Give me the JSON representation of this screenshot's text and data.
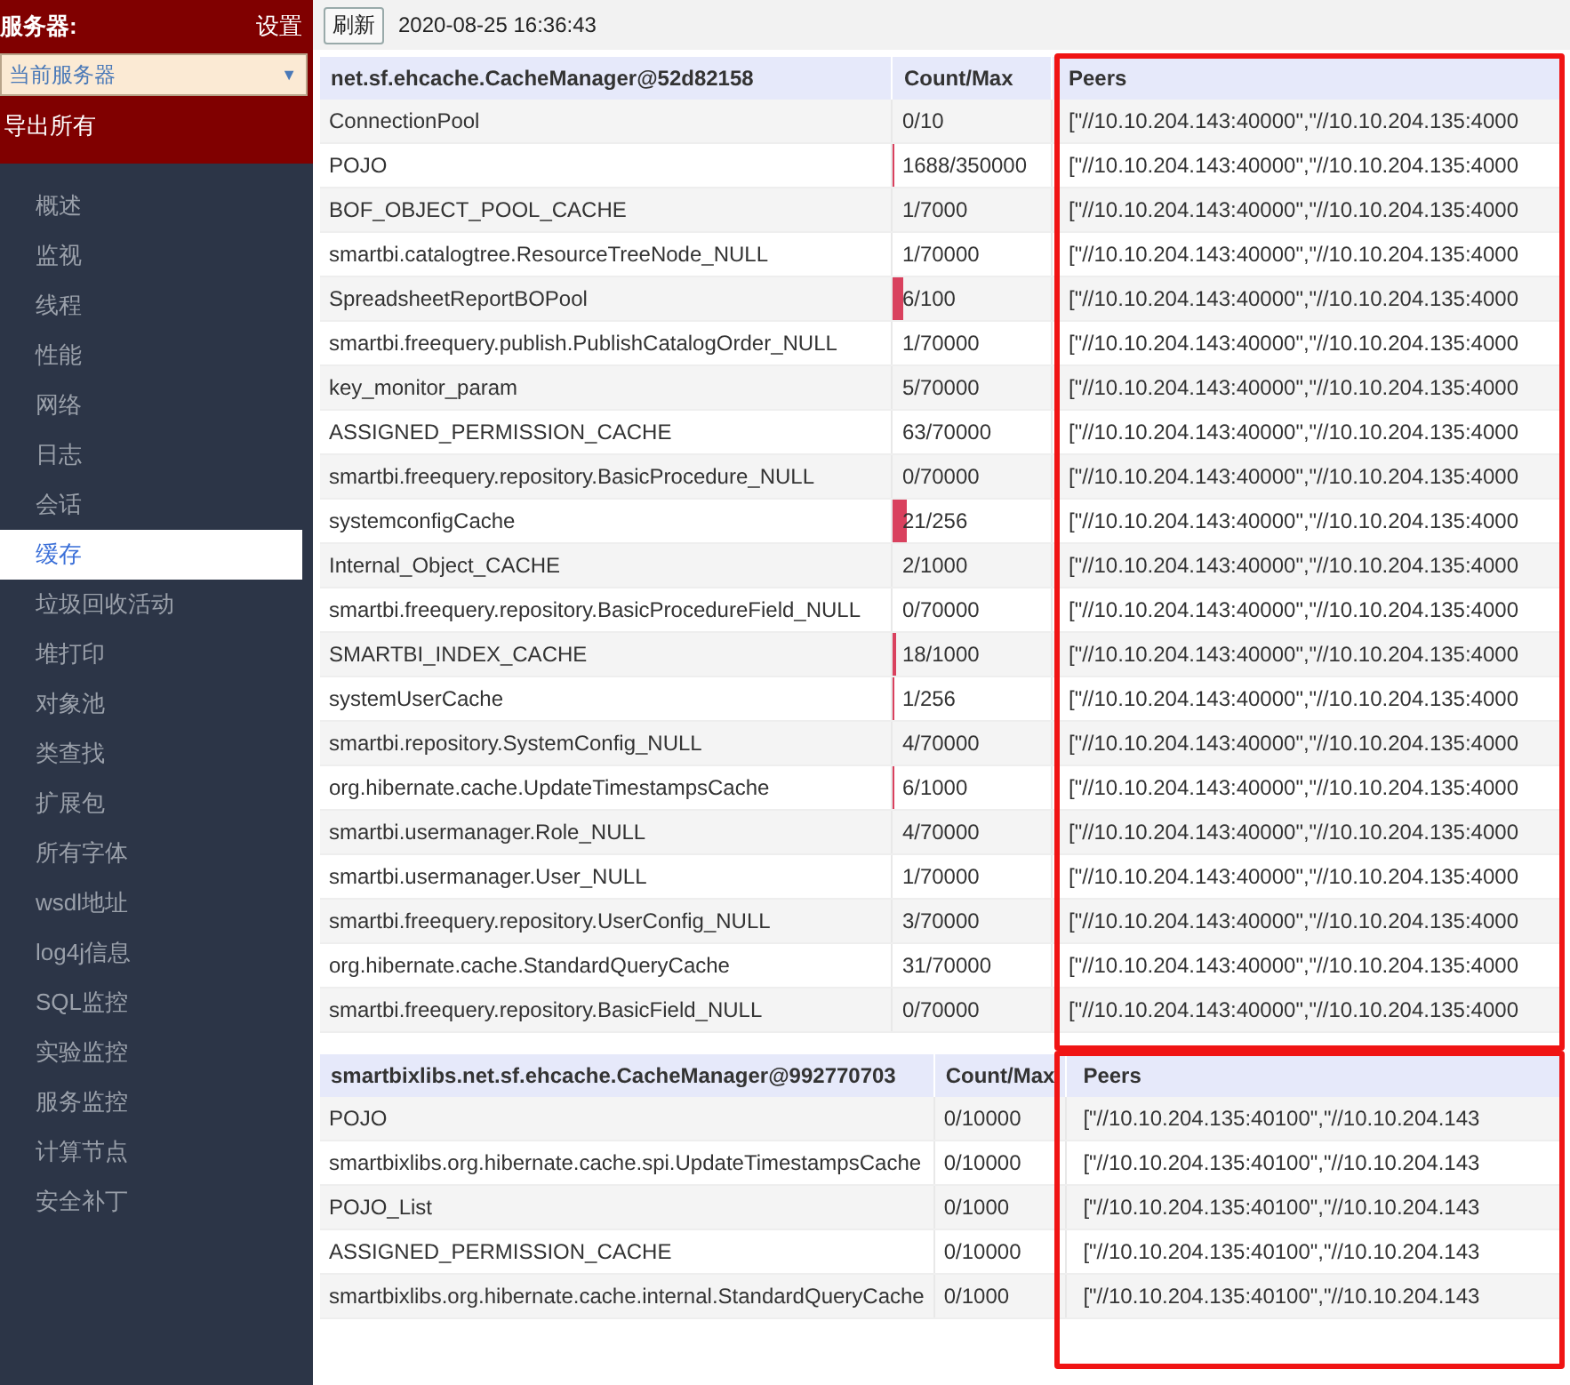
{
  "sidebar": {
    "title": "服务器:",
    "settings_link": "设置",
    "server_select": {
      "value": "当前服务器",
      "arrow": "▼"
    },
    "export_link": "导出所有",
    "items": [
      {
        "label": "概述",
        "selected": false
      },
      {
        "label": "监视",
        "selected": false
      },
      {
        "label": "线程",
        "selected": false
      },
      {
        "label": "性能",
        "selected": false
      },
      {
        "label": "网络",
        "selected": false
      },
      {
        "label": "日志",
        "selected": false
      },
      {
        "label": "会话",
        "selected": false
      },
      {
        "label": "缓存",
        "selected": true
      },
      {
        "label": "垃圾回收活动",
        "selected": false
      },
      {
        "label": "堆打印",
        "selected": false
      },
      {
        "label": "对象池",
        "selected": false
      },
      {
        "label": "类查找",
        "selected": false
      },
      {
        "label": "扩展包",
        "selected": false
      },
      {
        "label": "所有字体",
        "selected": false
      },
      {
        "label": "wsdl地址",
        "selected": false
      },
      {
        "label": "log4j信息",
        "selected": false
      },
      {
        "label": "SQL监控",
        "selected": false
      },
      {
        "label": "实验监控",
        "selected": false
      },
      {
        "label": "服务监控",
        "selected": false
      },
      {
        "label": "计算节点",
        "selected": false
      },
      {
        "label": "安全补丁",
        "selected": false
      }
    ]
  },
  "toolbar": {
    "refresh_button": "刷新",
    "timestamp": "2020-08-25 16:36:43"
  },
  "tables": [
    {
      "columns": [
        "net.sf.ehcache.CacheManager@52d82158",
        "Count/Max",
        "Peers"
      ],
      "highlighted": true,
      "rows": [
        {
          "name": "ConnectionPool",
          "count": "0/10",
          "peers": "[\"//10.10.204.143:40000\",\"//10.10.204.135:4000"
        },
        {
          "name": "POJO",
          "count": "1688/350000",
          "level": 0.005,
          "peers": "[\"//10.10.204.143:40000\",\"//10.10.204.135:4000"
        },
        {
          "name": "BOF_OBJECT_POOL_CACHE",
          "count": "1/7000",
          "peers": "[\"//10.10.204.143:40000\",\"//10.10.204.135:4000"
        },
        {
          "name": "smartbi.catalogtree.ResourceTreeNode_NULL",
          "count": "1/70000",
          "peers": "[\"//10.10.204.143:40000\",\"//10.10.204.135:4000"
        },
        {
          "name": "SpreadsheetReportBOPool",
          "count": "6/100",
          "level": 0.06,
          "peers": "[\"//10.10.204.143:40000\",\"//10.10.204.135:4000"
        },
        {
          "name": "smartbi.freequery.publish.PublishCatalogOrder_NULL",
          "count": "1/70000",
          "peers": "[\"//10.10.204.143:40000\",\"//10.10.204.135:4000"
        },
        {
          "name": "key_monitor_param",
          "count": "5/70000",
          "peers": "[\"//10.10.204.143:40000\",\"//10.10.204.135:4000"
        },
        {
          "name": "ASSIGNED_PERMISSION_CACHE",
          "count": "63/70000",
          "peers": "[\"//10.10.204.143:40000\",\"//10.10.204.135:4000"
        },
        {
          "name": "smartbi.freequery.repository.BasicProcedure_NULL",
          "count": "0/70000",
          "peers": "[\"//10.10.204.143:40000\",\"//10.10.204.135:4000"
        },
        {
          "name": "systemconfigCache",
          "count": "21/256",
          "level": 0.082,
          "peers": "[\"//10.10.204.143:40000\",\"//10.10.204.135:4000"
        },
        {
          "name": "Internal_Object_CACHE",
          "count": "2/1000",
          "peers": "[\"//10.10.204.143:40000\",\"//10.10.204.135:4000"
        },
        {
          "name": "smartbi.freequery.repository.BasicProcedureField_NULL",
          "count": "0/70000",
          "peers": "[\"//10.10.204.143:40000\",\"//10.10.204.135:4000"
        },
        {
          "name": "SMARTBI_INDEX_CACHE",
          "count": "18/1000",
          "level": 0.018,
          "peers": "[\"//10.10.204.143:40000\",\"//10.10.204.135:4000"
        },
        {
          "name": "systemUserCache",
          "count": "1/256",
          "level": 0.004,
          "peers": "[\"//10.10.204.143:40000\",\"//10.10.204.135:4000"
        },
        {
          "name": "smartbi.repository.SystemConfig_NULL",
          "count": "4/70000",
          "peers": "[\"//10.10.204.143:40000\",\"//10.10.204.135:4000"
        },
        {
          "name": "org.hibernate.cache.UpdateTimestampsCache",
          "count": "6/1000",
          "level": 0.006,
          "peers": "[\"//10.10.204.143:40000\",\"//10.10.204.135:4000"
        },
        {
          "name": "smartbi.usermanager.Role_NULL",
          "count": "4/70000",
          "peers": "[\"//10.10.204.143:40000\",\"//10.10.204.135:4000"
        },
        {
          "name": "smartbi.usermanager.User_NULL",
          "count": "1/70000",
          "peers": "[\"//10.10.204.143:40000\",\"//10.10.204.135:4000"
        },
        {
          "name": "smartbi.freequery.repository.UserConfig_NULL",
          "count": "3/70000",
          "peers": "[\"//10.10.204.143:40000\",\"//10.10.204.135:4000"
        },
        {
          "name": "org.hibernate.cache.StandardQueryCache",
          "count": "31/70000",
          "peers": "[\"//10.10.204.143:40000\",\"//10.10.204.135:4000"
        },
        {
          "name": "smartbi.freequery.repository.BasicField_NULL",
          "count": "0/70000",
          "peers": "[\"//10.10.204.143:40000\",\"//10.10.204.135:4000"
        }
      ]
    },
    {
      "columns": [
        "smartbixlibs.net.sf.ehcache.CacheManager@992770703",
        "Count/Max",
        "Peers"
      ],
      "highlighted": true,
      "rows": [
        {
          "name": "POJO",
          "count": "0/10000",
          "peers": "[\"//10.10.204.135:40100\",\"//10.10.204.143"
        },
        {
          "name": "smartbixlibs.org.hibernate.cache.spi.UpdateTimestampsCache",
          "count": "0/10000",
          "peers": "[\"//10.10.204.135:40100\",\"//10.10.204.143"
        },
        {
          "name": "POJO_List",
          "count": "0/1000",
          "peers": "[\"//10.10.204.135:40100\",\"//10.10.204.143"
        },
        {
          "name": "ASSIGNED_PERMISSION_CACHE",
          "count": "0/10000",
          "peers": "[\"//10.10.204.135:40100\",\"//10.10.204.143"
        },
        {
          "name": "smartbixlibs.org.hibernate.cache.internal.StandardQueryCache",
          "count": "0/1000",
          "peers": "[\"//10.10.204.135:40100\",\"//10.10.204.143"
        }
      ]
    }
  ]
}
